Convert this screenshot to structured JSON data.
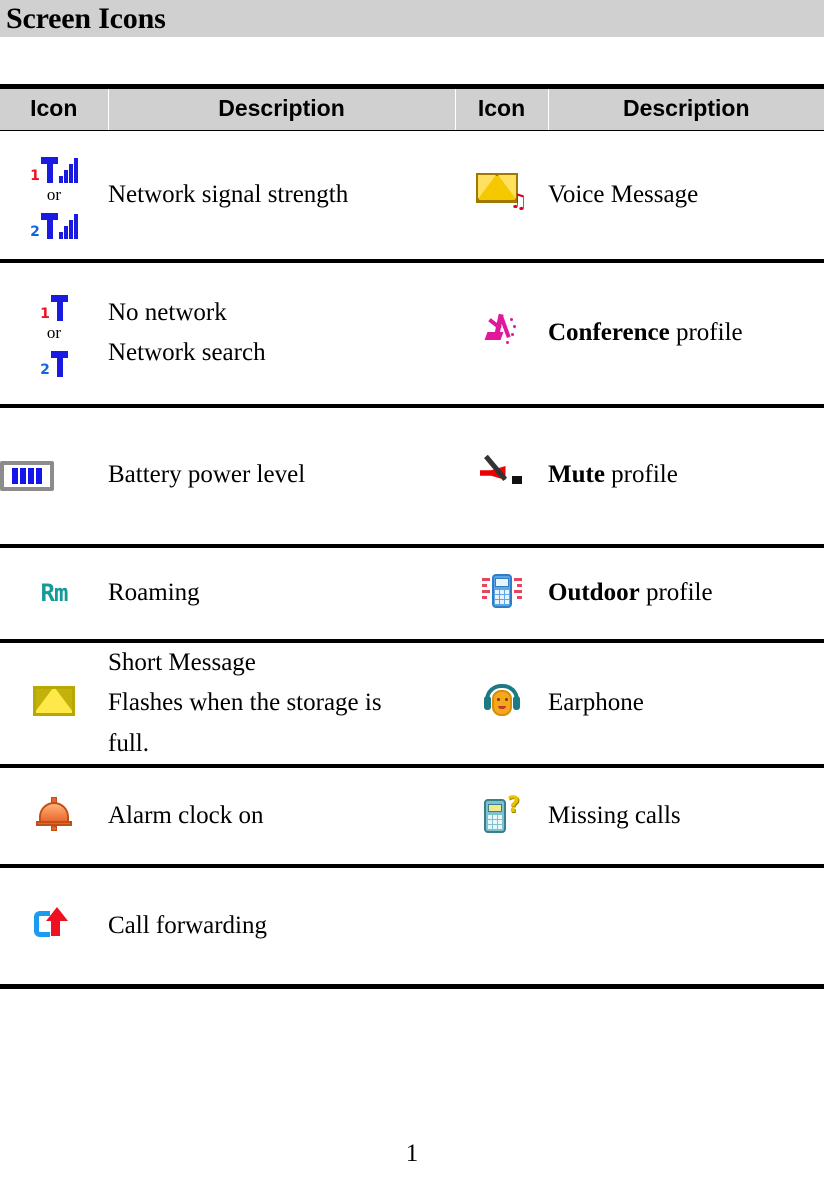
{
  "document": {
    "title": "Screen Icons",
    "page_number": "1"
  },
  "table": {
    "headers": [
      "Icon",
      "Description",
      "Icon",
      "Description"
    ],
    "or_label": "or",
    "rows": [
      {
        "left_icon": "network-signal-strength-icon",
        "left_desc": "Network signal strength",
        "right_icon": "voice-message-icon",
        "right_desc_bold": "",
        "right_desc": "Voice Message"
      },
      {
        "left_icon": "no-network-icon",
        "left_desc_line1": "No network",
        "left_desc_line2": "Network search",
        "right_icon": "conference-profile-icon",
        "right_desc_bold": "Conference",
        "right_desc": " profile"
      },
      {
        "left_icon": "battery-power-level-icon",
        "left_desc": "Battery power level",
        "right_icon": "mute-profile-icon",
        "right_desc_bold": "Mute",
        "right_desc": " profile"
      },
      {
        "left_icon": "roaming-icon",
        "left_desc": "Roaming",
        "right_icon": "outdoor-profile-icon",
        "right_desc_bold": "Outdoor",
        "right_desc": " profile"
      },
      {
        "left_icon": "short-message-icon",
        "left_desc_line1": "Short Message",
        "left_desc_line2": "Flashes when the storage is",
        "left_desc_line3": "full.",
        "right_icon": "earphone-icon",
        "right_desc_bold": "",
        "right_desc": "Earphone"
      },
      {
        "left_icon": "alarm-clock-on-icon",
        "left_desc": "Alarm clock on",
        "right_icon": "missing-calls-icon",
        "right_desc_bold": "",
        "right_desc": "Missing calls"
      },
      {
        "left_icon": "call-forwarding-icon",
        "left_desc": "Call forwarding",
        "right_icon": "",
        "right_desc_bold": "",
        "right_desc": ""
      }
    ],
    "icon_labels": {
      "signal_digit_1": "1",
      "signal_digit_2": "2",
      "roaming_text": "Rm",
      "voice_note_glyph": "♫",
      "missing_call_glyph": "?"
    }
  },
  "colors": {
    "banner_background": "#d0d0d0",
    "header_background": "#d0d0d0",
    "rule": "#000000",
    "signal_blue": "#1a1ae0",
    "signal_digit_red": "#ee1122",
    "signal_digit_blue": "#1166dd",
    "battery_fill": "#1414ee",
    "roaming_teal": "#159a9a",
    "envelope_yellow": "#ffe94a",
    "conference_pink": "#e0189c",
    "mute_red": "#ee0000",
    "outdoor_blue": "#5aa6e8",
    "outdoor_vibration_red": "#e8455a",
    "earphone_orange": "#f3a81e",
    "earphone_band_teal": "#1b7a82",
    "bell_orange": "#e8642a",
    "missing_call_teal": "#7cc3cd",
    "missing_call_yellow": "#e8c400",
    "forward_blue": "#1a9bf0",
    "forward_red": "#ee1122"
  }
}
